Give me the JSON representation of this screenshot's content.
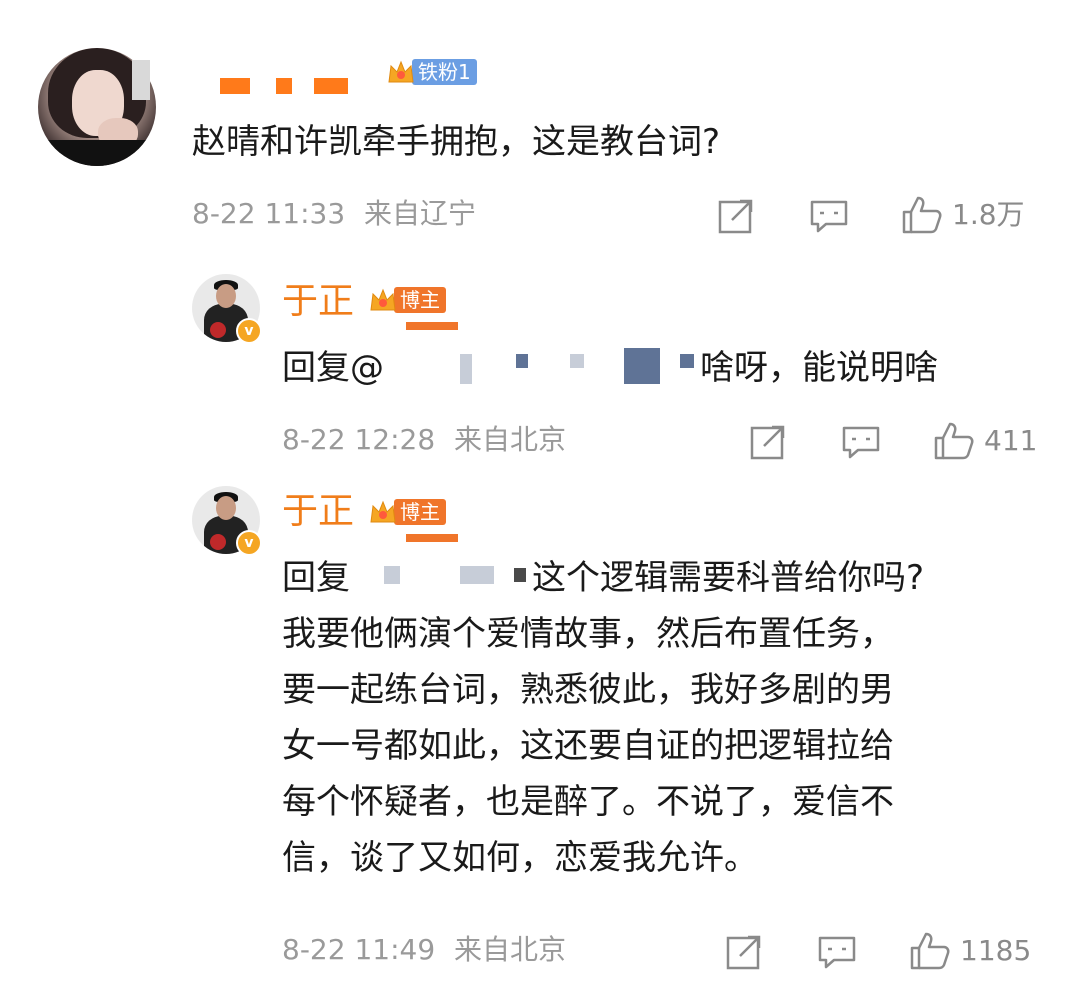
{
  "top_comment": {
    "fan_badge": "铁粉1",
    "text": "赵晴和许凯牵手拥抱，这是教台词?",
    "date": "8-22 11:33",
    "location": "来自辽宁",
    "like_count": "1.8万"
  },
  "reply1": {
    "author": "于正",
    "badge": "博主",
    "prefix": "回复@",
    "text_tail": "啥呀，能说明啥",
    "date": "8-22 12:28",
    "location": "来自北京",
    "like_count": "411"
  },
  "reply2": {
    "author": "于正",
    "badge": "博主",
    "prefix": "回复",
    "lines": [
      "这个逻辑需要科普给你吗?",
      "我要他俩演个爱情故事，然后布置任务，",
      "要一起练台词，熟悉彼此，我好多剧的男",
      "女一号都如此，这还要自证的把逻辑拉给",
      "每个怀疑者，也是醉了。不说了，爱信不",
      "信，谈了又如何，恋爱我允许。"
    ],
    "date": "8-22 11:49",
    "location": "来自北京",
    "like_count": "1185"
  },
  "colors": {
    "author_orange": "#f07d1a",
    "badge_blue": "#6b9ee3",
    "badge_orange": "#f0752a",
    "meta_gray": "#9a9a9a"
  },
  "icons": [
    "share-icon",
    "comment-icon",
    "like-icon",
    "crown-icon",
    "verified-icon"
  ]
}
